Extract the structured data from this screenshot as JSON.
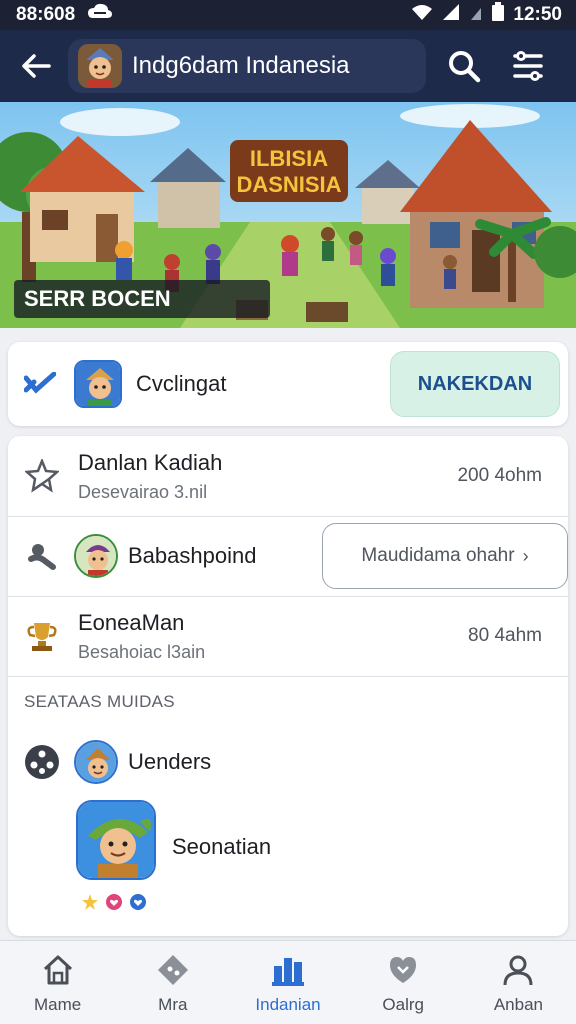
{
  "status_bar": {
    "time_left": "88:608",
    "time_right": "12:50"
  },
  "app_bar": {
    "title": "Indg6dam Indanesia"
  },
  "banner": {
    "logo_line1": "ILBISIA",
    "logo_line2": "DASNISIA",
    "label": "SERR BOCEN"
  },
  "featured": {
    "name": "Cvclingat",
    "button_label": "NAKEKDAN"
  },
  "list": {
    "items": [
      {
        "title": "Danlan Kadiah",
        "subtitle": "Desevairao 3.nil",
        "meta": "200 4ohm"
      },
      {
        "title": "Babashpoind",
        "action_label": "Maudidama ohahr"
      },
      {
        "title": "EoneaMan",
        "subtitle": "Besahoiac l3ain",
        "meta": "80 4ahm"
      }
    ],
    "section_header": "SEATAAS MUIDAS",
    "section_user": "Uenders",
    "section_app": "Seonatian"
  },
  "bottom_nav": {
    "items": [
      {
        "label": "Mame"
      },
      {
        "label": "Mra"
      },
      {
        "label": "Indanian"
      },
      {
        "label": "Oalrg"
      },
      {
        "label": "Anban"
      }
    ],
    "active_color": "#2d6fd0"
  },
  "colors": {
    "app_bar": "#1e2a4a",
    "status_bar": "#1c2233",
    "accent": "#2d6fd0",
    "button_mint": "#d7f1e6"
  }
}
